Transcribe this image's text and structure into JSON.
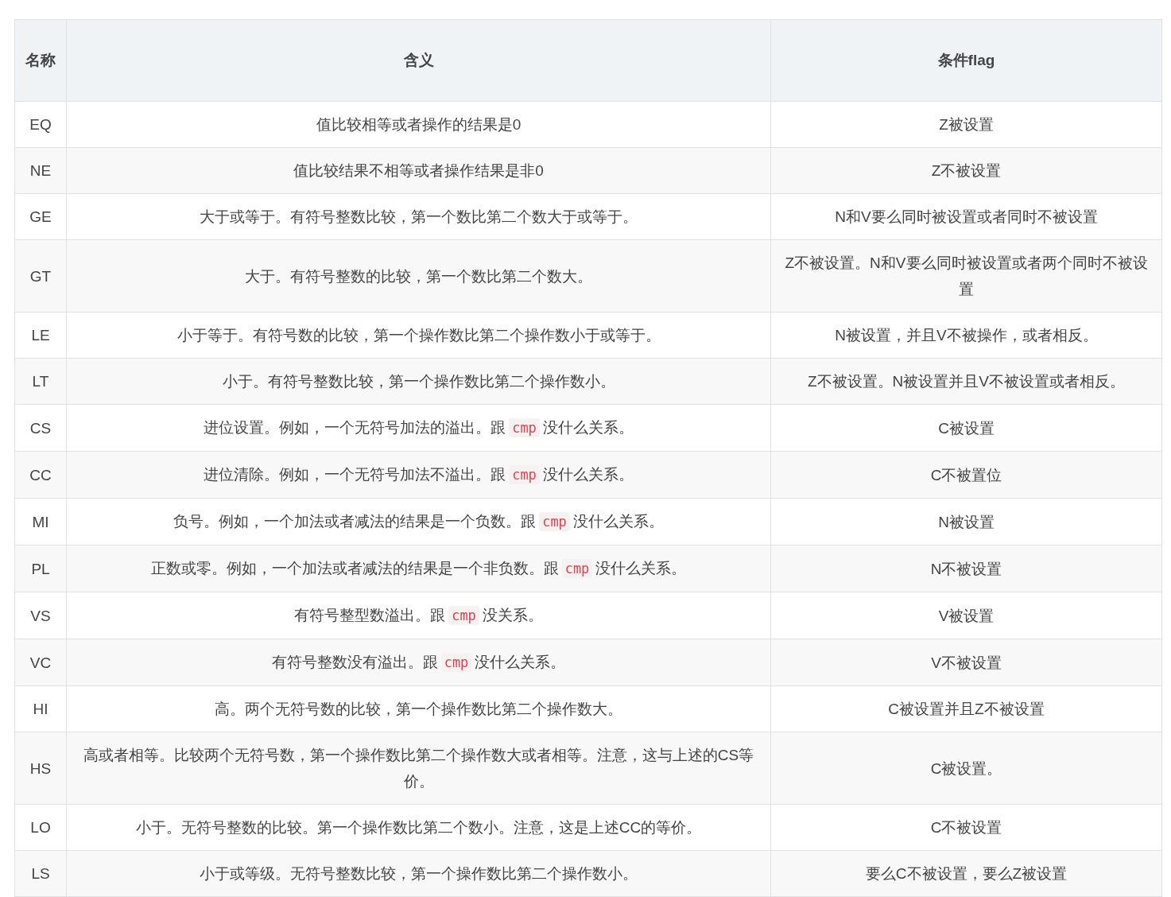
{
  "table": {
    "columns": [
      "名称",
      "含义",
      "条件flag"
    ],
    "rows": [
      {
        "name": "EQ",
        "meaning": [
          {
            "kind": "text",
            "text": "值比较相等或者操作的结果是0"
          }
        ],
        "flag": "Z被设置"
      },
      {
        "name": "NE",
        "meaning": [
          {
            "kind": "text",
            "text": "值比较结果不相等或者操作结果是非0"
          }
        ],
        "flag": "Z不被设置"
      },
      {
        "name": "GE",
        "meaning": [
          {
            "kind": "text",
            "text": "大于或等于。有符号整数比较，第一个数比第二个数大于或等于。"
          }
        ],
        "flag": "N和V要么同时被设置或者同时不被设置"
      },
      {
        "name": "GT",
        "meaning": [
          {
            "kind": "text",
            "text": "大于。有符号整数的比较，第一个数比第二个数大。"
          }
        ],
        "flag": "Z不被设置。N和V要么同时被设置或者两个同时不被设置"
      },
      {
        "name": "LE",
        "meaning": [
          {
            "kind": "text",
            "text": "小于等于。有符号数的比较，第一个操作数比第二个操作数小于或等于。"
          }
        ],
        "flag": "N被设置，并且V不被操作，或者相反。"
      },
      {
        "name": "LT",
        "meaning": [
          {
            "kind": "text",
            "text": "小于。有符号整数比较，第一个操作数比第二个操作数小。"
          }
        ],
        "flag": "Z不被设置。N被设置并且V不被设置或者相反。"
      },
      {
        "name": "CS",
        "meaning": [
          {
            "kind": "text",
            "text": "进位设置。例如，一个无符号加法的溢出。跟"
          },
          {
            "kind": "code",
            "text": "cmp"
          },
          {
            "kind": "text",
            "text": "没什么关系。"
          }
        ],
        "flag": "C被设置"
      },
      {
        "name": "CC",
        "meaning": [
          {
            "kind": "text",
            "text": "进位清除。例如，一个无符号加法不溢出。跟"
          },
          {
            "kind": "code",
            "text": "cmp"
          },
          {
            "kind": "text",
            "text": "没什么关系。"
          }
        ],
        "flag": "C不被置位"
      },
      {
        "name": "MI",
        "meaning": [
          {
            "kind": "text",
            "text": "负号。例如，一个加法或者减法的结果是一个负数。跟"
          },
          {
            "kind": "code",
            "text": "cmp"
          },
          {
            "kind": "text",
            "text": "没什么关系。"
          }
        ],
        "flag": "N被设置"
      },
      {
        "name": "PL",
        "meaning": [
          {
            "kind": "text",
            "text": "正数或零。例如，一个加法或者减法的结果是一个非负数。跟"
          },
          {
            "kind": "code",
            "text": "cmp"
          },
          {
            "kind": "text",
            "text": "没什么关系。"
          }
        ],
        "flag": "N不被设置"
      },
      {
        "name": "VS",
        "meaning": [
          {
            "kind": "text",
            "text": "有符号整型数溢出。跟"
          },
          {
            "kind": "code",
            "text": "cmp"
          },
          {
            "kind": "text",
            "text": "没关系。"
          }
        ],
        "flag": "V被设置"
      },
      {
        "name": "VC",
        "meaning": [
          {
            "kind": "text",
            "text": "有符号整数没有溢出。跟"
          },
          {
            "kind": "code",
            "text": "cmp"
          },
          {
            "kind": "text",
            "text": "没什么关系。"
          }
        ],
        "flag": "V不被设置"
      },
      {
        "name": "HI",
        "meaning": [
          {
            "kind": "text",
            "text": "高。两个无符号数的比较，第一个操作数比第二个操作数大。"
          }
        ],
        "flag": "C被设置并且Z不被设置"
      },
      {
        "name": "HS",
        "meaning": [
          {
            "kind": "text",
            "text": "高或者相等。比较两个无符号数，第一个操作数比第二个操作数大或者相等。注意，这与上述的CS等价。"
          }
        ],
        "flag": "C被设置。"
      },
      {
        "name": "LO",
        "meaning": [
          {
            "kind": "text",
            "text": "小于。无符号整数的比较。第一个操作数比第二个数小。注意，这是上述CC的等价。"
          }
        ],
        "flag": "C不被设置"
      },
      {
        "name": "LS",
        "meaning": [
          {
            "kind": "text",
            "text": "小于或等级。无符号整数比较，第一个操作数比第二个操作数小。"
          }
        ],
        "flag": "要么C不被设置，要么Z被设置"
      }
    ]
  }
}
